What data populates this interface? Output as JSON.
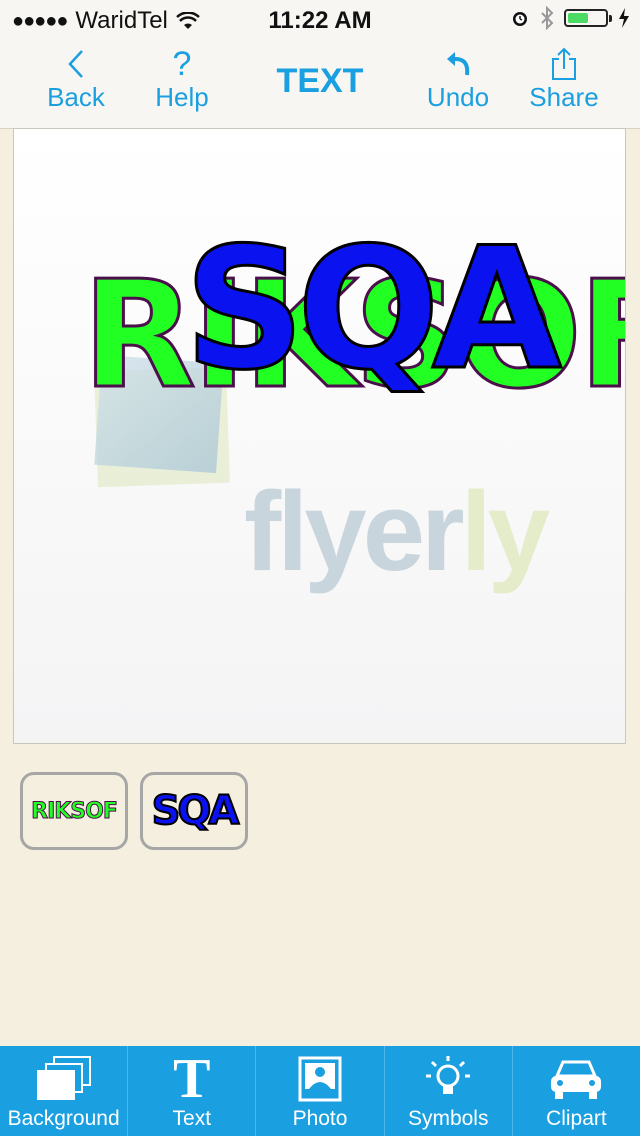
{
  "status_bar": {
    "carrier": "WaridTel",
    "time": "11:22 AM",
    "battery_level": 0.55
  },
  "nav": {
    "back_label": "Back",
    "help_label": "Help",
    "title": "TEXT",
    "undo_label": "Undo",
    "share_label": "Share"
  },
  "canvas": {
    "watermark_text_a": "flyer",
    "watermark_text_b": "ly",
    "layer1_text": "RIKSOF",
    "layer2_text": "SQA"
  },
  "layers": [
    {
      "text": "RIKSOF"
    },
    {
      "text": "SQA"
    }
  ],
  "tabs": [
    {
      "label": "Background",
      "icon": "background-layers-icon"
    },
    {
      "label": "Text",
      "icon": "text-t-icon"
    },
    {
      "label": "Photo",
      "icon": "photo-portrait-icon"
    },
    {
      "label": "Symbols",
      "icon": "lightbulb-icon"
    },
    {
      "label": "Clipart",
      "icon": "car-icon"
    }
  ],
  "colors": {
    "accent": "#1a9fe0",
    "layer1_fill": "#22ff22",
    "layer1_stroke": "#4b0f4b",
    "layer2_fill": "#0a12f0",
    "layer2_stroke": "#000000",
    "background": "#f5efdf"
  }
}
